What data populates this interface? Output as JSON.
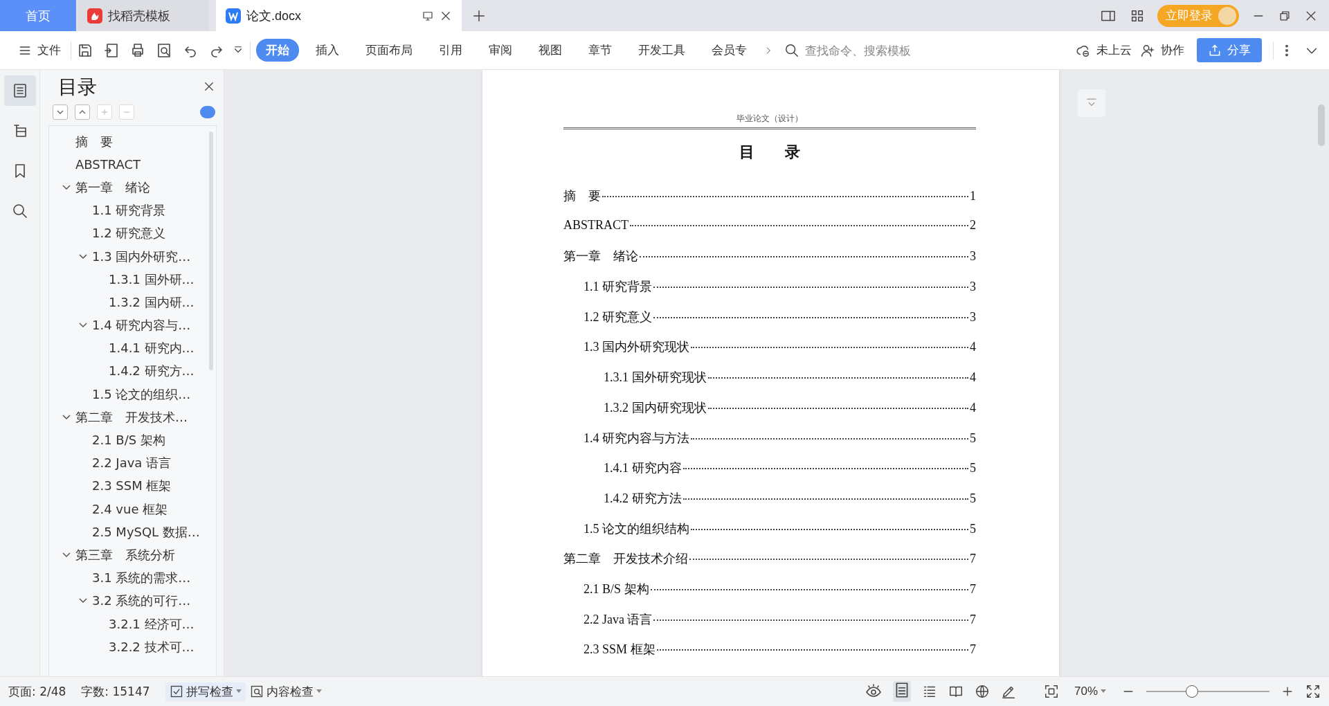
{
  "tabs": [
    {
      "label": "首页",
      "kind": "home",
      "selected": false
    },
    {
      "label": "找稻壳模板",
      "kind": "docer",
      "selected": false
    },
    {
      "label": "论文.docx",
      "kind": "doc",
      "selected": true
    }
  ],
  "account": {
    "login": "立即登录"
  },
  "toolbar": {
    "file_menu": "文件",
    "ribbon_tabs": [
      {
        "label": "开始",
        "selected": true
      },
      {
        "label": "插入",
        "selected": false
      },
      {
        "label": "页面布局",
        "selected": false
      },
      {
        "label": "引用",
        "selected": false
      },
      {
        "label": "审阅",
        "selected": false
      },
      {
        "label": "视图",
        "selected": false
      },
      {
        "label": "章节",
        "selected": false
      },
      {
        "label": "开发工具",
        "selected": false
      },
      {
        "label": "会员专",
        "selected": false
      }
    ],
    "search": {
      "placeholder": "查找命令、搜索模板"
    },
    "cloud": "未上云",
    "collaborate": "协作",
    "share": "分享"
  },
  "rail": [
    {
      "kind": "outline",
      "selected": true
    },
    {
      "kind": "nav",
      "selected": false
    },
    {
      "kind": "bookmark",
      "selected": false
    },
    {
      "kind": "search",
      "selected": false
    }
  ],
  "sidebar": {
    "title": "目录",
    "items": [
      {
        "label": "摘　要"
      },
      {
        "label": "ABSTRACT"
      },
      {
        "label": "第一章　绪论",
        "expanded": true,
        "children": [
          {
            "label": "1.1 研究背景"
          },
          {
            "label": "1.2 研究意义"
          },
          {
            "label": "1.3 国内外研究…",
            "expanded": true,
            "children": [
              {
                "label": "1.3.1 国外研…"
              },
              {
                "label": "1.3.2 国内研…"
              }
            ]
          },
          {
            "label": "1.4 研究内容与…",
            "expanded": true,
            "children": [
              {
                "label": "1.4.1 研究内…"
              },
              {
                "label": "1.4.2 研究方…"
              }
            ]
          },
          {
            "label": "1.5 论文的组织…"
          }
        ]
      },
      {
        "label": "第二章　开发技术…",
        "expanded": true,
        "children": [
          {
            "label": "2.1 B/S 架构"
          },
          {
            "label": "2.2 Java 语言"
          },
          {
            "label": "2.3 SSM 框架"
          },
          {
            "label": "2.4 vue 框架"
          },
          {
            "label": "2.5 MySQL 数据…"
          }
        ]
      },
      {
        "label": "第三章　系统分析",
        "expanded": true,
        "children": [
          {
            "label": "3.1 系统的需求…"
          },
          {
            "label": "3.2 系统的可行…",
            "expanded": true,
            "children": [
              {
                "label": "3.2.1 经济可…"
              },
              {
                "label": "3.2.2 技术可…"
              }
            ]
          }
        ]
      }
    ]
  },
  "document": {
    "header": "毕业论文（设计）",
    "title": "目　　录",
    "toc": [
      {
        "title": "摘　要",
        "page": "1"
      },
      {
        "title": "ABSTRACT",
        "page": "2"
      },
      {
        "title": "第一章　绪论",
        "page": "3",
        "children": [
          {
            "title": "1.1 研究背景",
            "page": "3"
          },
          {
            "title": "1.2 研究意义",
            "page": "3"
          },
          {
            "title": "1.3 国内外研究现状",
            "page": "4",
            "children": [
              {
                "title": "1.3.1 国外研究现状",
                "page": "4"
              },
              {
                "title": "1.3.2 国内研究现状",
                "page": "4"
              }
            ]
          },
          {
            "title": "1.4 研究内容与方法",
            "page": "5",
            "children": [
              {
                "title": "1.4.1 研究内容",
                "page": "5"
              },
              {
                "title": "1.4.2 研究方法",
                "page": "5"
              }
            ]
          },
          {
            "title": "1.5 论文的组织结构",
            "page": "5"
          }
        ]
      },
      {
        "title": "第二章　开发技术介绍",
        "page": "7",
        "children": [
          {
            "title": "2.1 B/S 架构",
            "page": "7"
          },
          {
            "title": "2.2 Java 语言",
            "page": "7"
          },
          {
            "title": "2.3 SSM 框架",
            "page": "7"
          }
        ]
      }
    ]
  },
  "status_bar": {
    "page": "页面: 2/48",
    "words": "字数: 15147",
    "spell_check": "拼写检查",
    "content_check": "内容检查",
    "zoom": "70%",
    "zoom_slider": {
      "level": 0.37
    }
  }
}
